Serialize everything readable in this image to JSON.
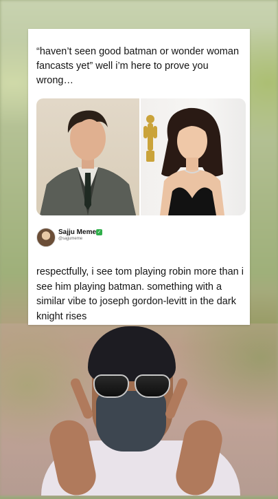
{
  "post": {
    "quote_text": "“haven’t seen good batman or wonder woman fancasts yet” well i’m here to prove you wrong…",
    "images": [
      {
        "icon": "portrait-man-icon"
      },
      {
        "icon": "portrait-woman-icon"
      }
    ]
  },
  "reply": {
    "account_name": "Sajju Meme",
    "handle": "@sajjumeme",
    "verified_icon": "verified-check-icon",
    "text": "respectfully, i see tom playing robin more than i see him playing batman. something with a similar vibe to joseph gordon-levitt in the dark knight rises"
  },
  "colors": {
    "card_background": "#ffffff",
    "text": "#141414",
    "verified": "#2fae4a"
  }
}
